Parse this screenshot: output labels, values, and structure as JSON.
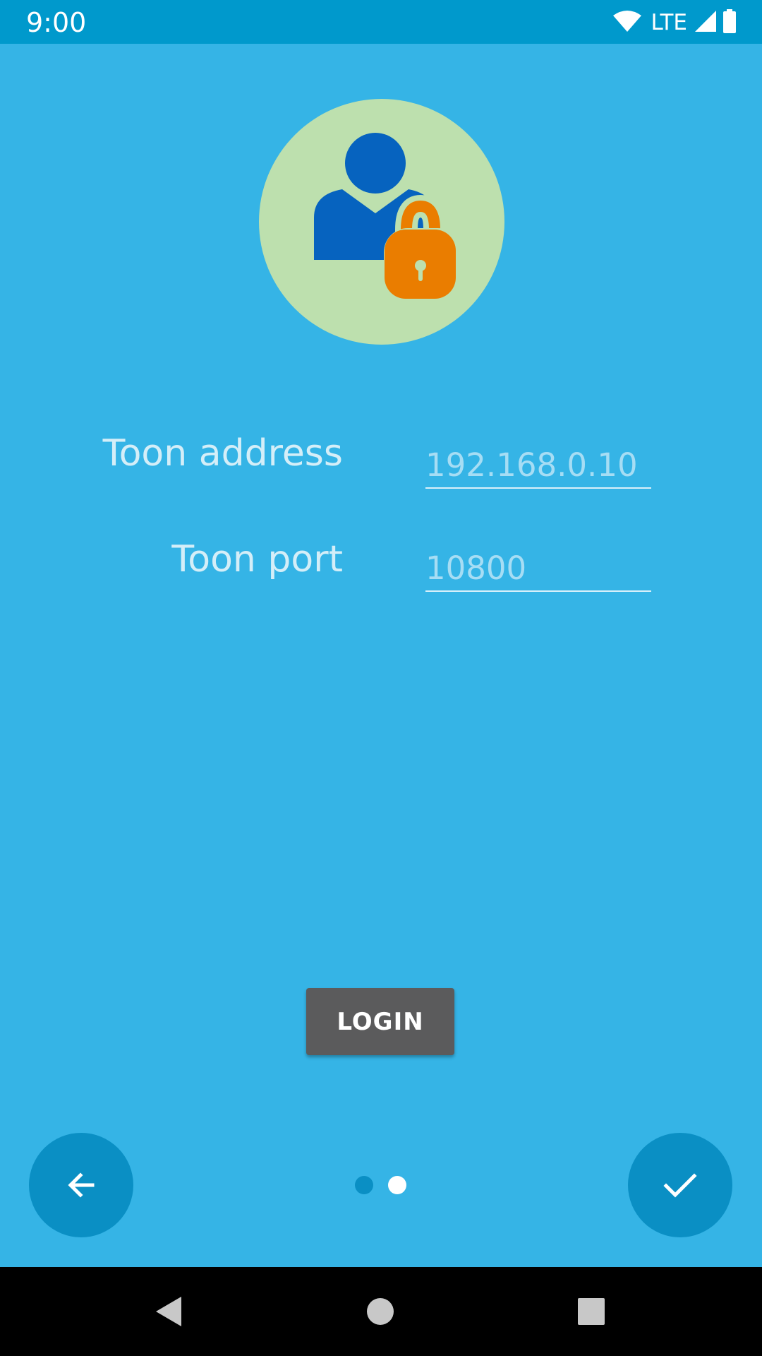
{
  "status_bar": {
    "time": "9:00",
    "network": "LTE",
    "icons": [
      "wifi-icon",
      "cell-signal-icon",
      "battery-icon"
    ]
  },
  "avatar": {
    "icon": "user-lock-icon",
    "colors": {
      "circle": "#BDE0AE",
      "person": "#0663BF",
      "lock": "#EA7D00"
    }
  },
  "form": {
    "address_label": "Toon address",
    "address_placeholder": "192.168.0.10",
    "address_value": "",
    "port_label": "Toon port",
    "port_placeholder": "10800",
    "port_value": ""
  },
  "actions": {
    "login_label": "LOGIN"
  },
  "onboarding": {
    "back_icon": "arrow-back-icon",
    "done_icon": "check-icon",
    "page_count": 2,
    "current_page": 2
  },
  "nav_bar": {
    "icons": [
      "nav-back-icon",
      "nav-home-icon",
      "nav-recents-icon"
    ]
  },
  "colors": {
    "background": "#35B4E6",
    "status_bar": "#0099CC",
    "accent": "#0A8FC4",
    "button": "#5B5B5C"
  }
}
